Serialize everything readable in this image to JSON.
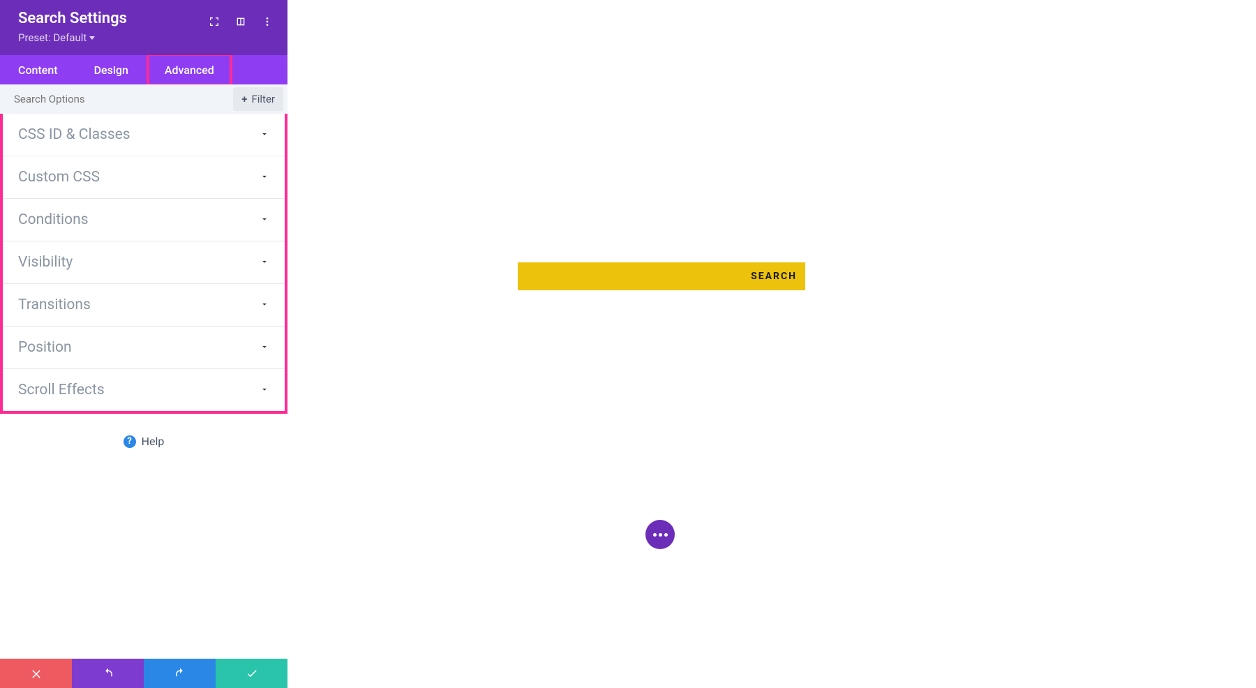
{
  "panel": {
    "title": "Search Settings",
    "preset_label": "Preset: Default"
  },
  "tabs": {
    "content": "Content",
    "design": "Design",
    "advanced": "Advanced"
  },
  "search_row": {
    "placeholder": "Search Options",
    "filter_label": "Filter"
  },
  "accordion": [
    {
      "label": "CSS ID & Classes"
    },
    {
      "label": "Custom CSS"
    },
    {
      "label": "Conditions"
    },
    {
      "label": "Visibility"
    },
    {
      "label": "Transitions"
    },
    {
      "label": "Position"
    },
    {
      "label": "Scroll Effects"
    }
  ],
  "help": {
    "label": "Help"
  },
  "preview": {
    "search_button": "SEARCH"
  },
  "colors": {
    "header_purple": "#6c2eb9",
    "tab_purple": "#8e3df2",
    "highlight_pink": "#ff2b94",
    "footer_red": "#ef5a61",
    "footer_purple": "#7e3bd0",
    "footer_blue": "#2b87e6",
    "footer_green": "#29c4a9",
    "search_yellow": "#edc20c"
  }
}
